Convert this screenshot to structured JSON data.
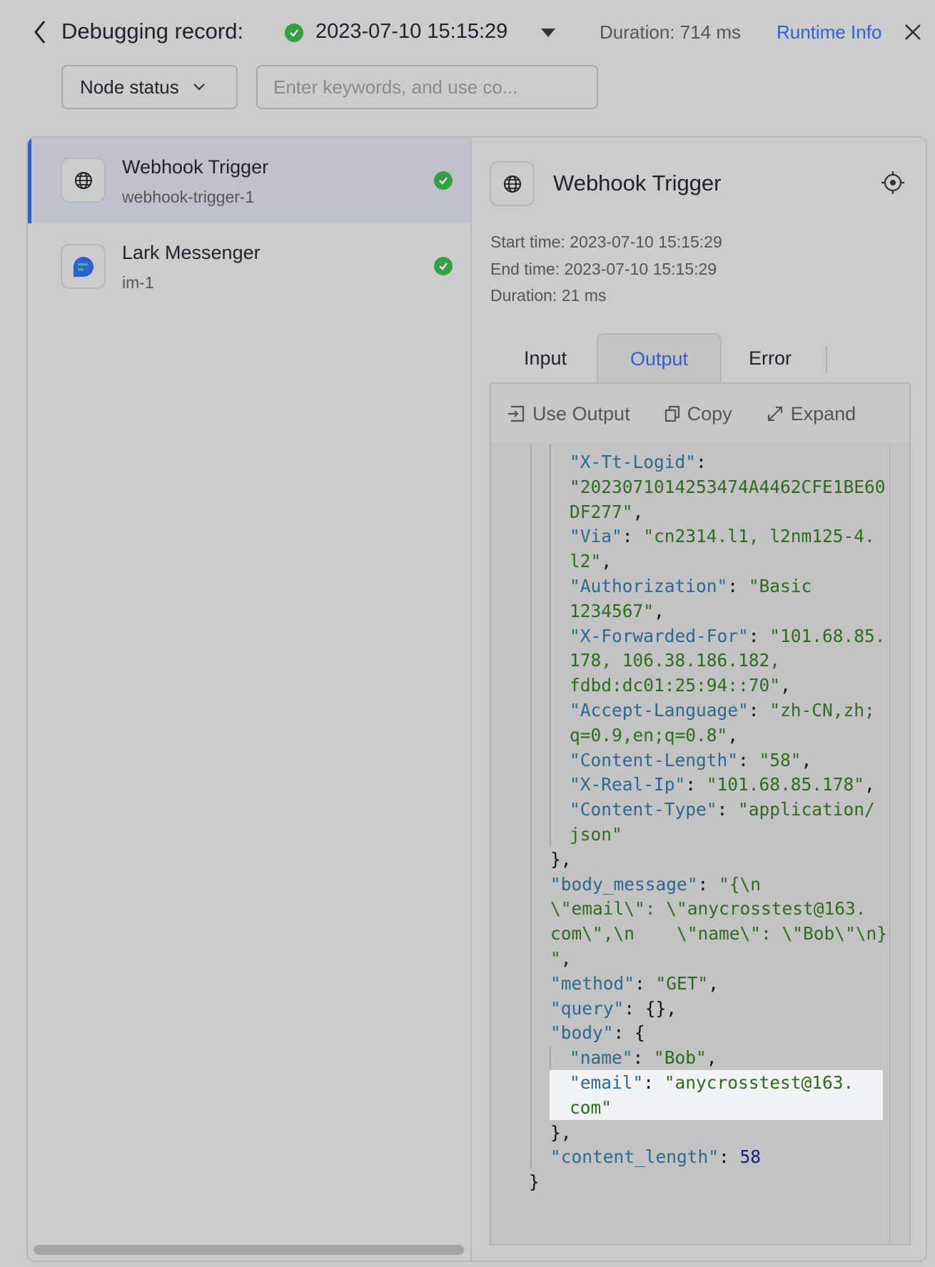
{
  "header": {
    "title": "Debugging record:",
    "record_time": "2023-07-10 15:15:29",
    "duration": "Duration: 714 ms",
    "runtime_info": "Runtime Info",
    "accent": "#2f5fd6",
    "success": "#34a043"
  },
  "filters": {
    "node_status": "Node status",
    "search_placeholder": "Enter keywords, and use co..."
  },
  "nodes": [
    {
      "title": "Webhook Trigger",
      "id": "webhook-trigger-1",
      "icon": "globe-icon",
      "status": "success",
      "selected": true
    },
    {
      "title": "Lark Messenger",
      "id": "im-1",
      "icon": "lark-messenger-icon",
      "status": "success",
      "selected": false
    }
  ],
  "detail": {
    "title": "Webhook Trigger",
    "start_time": "Start time: 2023-07-10 15:15:29",
    "end_time": "End time: 2023-07-10 15:15:29",
    "duration": "Duration: 21 ms",
    "tabs": [
      "Input",
      "Output",
      "Error"
    ],
    "active_tab": "Output",
    "toolbar": {
      "use_output": "Use Output",
      "copy": "Copy",
      "expand": "Expand"
    },
    "code_lines": [
      {
        "i": 2,
        "p": [
          [
            "k",
            "\"X-Tt-Logid\""
          ],
          [
            "p",
            ":"
          ]
        ]
      },
      {
        "i": 2,
        "p": [
          [
            "s",
            "\"2023071014253474A4462CFE1BE60"
          ]
        ]
      },
      {
        "i": 2,
        "p": [
          [
            "s",
            "DF277\""
          ],
          [
            "p",
            ","
          ]
        ]
      },
      {
        "i": 2,
        "p": [
          [
            "k",
            "\"Via\""
          ],
          [
            "p",
            ": "
          ],
          [
            "s",
            "\"cn2314.l1, l2nm125-4."
          ]
        ]
      },
      {
        "i": 2,
        "p": [
          [
            "s",
            "l2\""
          ],
          [
            "p",
            ","
          ]
        ]
      },
      {
        "i": 2,
        "p": [
          [
            "k",
            "\"Authorization\""
          ],
          [
            "p",
            ": "
          ],
          [
            "s",
            "\"Basic"
          ]
        ]
      },
      {
        "i": 2,
        "p": [
          [
            "s",
            "1234567\""
          ],
          [
            "p",
            ","
          ]
        ]
      },
      {
        "i": 2,
        "p": [
          [
            "k",
            "\"X-Forwarded-For\""
          ],
          [
            "p",
            ": "
          ],
          [
            "s",
            "\"101.68.85."
          ]
        ]
      },
      {
        "i": 2,
        "p": [
          [
            "s",
            "178, 106.38.186.182,"
          ]
        ]
      },
      {
        "i": 2,
        "p": [
          [
            "s",
            "fdbd:dc01:25:94::70\""
          ],
          [
            "p",
            ","
          ]
        ]
      },
      {
        "i": 2,
        "p": [
          [
            "k",
            "\"Accept-Language\""
          ],
          [
            "p",
            ": "
          ],
          [
            "s",
            "\"zh-CN,zh;"
          ]
        ]
      },
      {
        "i": 2,
        "p": [
          [
            "s",
            "q=0.9,en;q=0.8\""
          ],
          [
            "p",
            ","
          ]
        ]
      },
      {
        "i": 2,
        "p": [
          [
            "k",
            "\"Content-Length\""
          ],
          [
            "p",
            ": "
          ],
          [
            "s",
            "\"58\""
          ],
          [
            "p",
            ","
          ]
        ]
      },
      {
        "i": 2,
        "p": [
          [
            "k",
            "\"X-Real-Ip\""
          ],
          [
            "p",
            ": "
          ],
          [
            "s",
            "\"101.68.85.178\""
          ],
          [
            "p",
            ","
          ]
        ]
      },
      {
        "i": 2,
        "p": [
          [
            "k",
            "\"Content-Type\""
          ],
          [
            "p",
            ": "
          ],
          [
            "s",
            "\"application/"
          ]
        ]
      },
      {
        "i": 2,
        "p": [
          [
            "s",
            "json\""
          ]
        ]
      },
      {
        "i": 1,
        "p": [
          [
            "p",
            "},"
          ]
        ]
      },
      {
        "i": 1,
        "p": [
          [
            "k",
            "\"body_message\""
          ],
          [
            "p",
            ": "
          ],
          [
            "s",
            "\"{\\n"
          ]
        ]
      },
      {
        "i": 1,
        "p": [
          [
            "s",
            "\\\"email\\\": \\\"anycrosstest@163."
          ]
        ]
      },
      {
        "i": 1,
        "p": [
          [
            "s",
            "com\\\",\\n    \\\"name\\\": \\\"Bob\\\"\\n}"
          ]
        ]
      },
      {
        "i": 1,
        "p": [
          [
            "s",
            "\""
          ],
          [
            "p",
            ","
          ]
        ]
      },
      {
        "i": 1,
        "p": [
          [
            "k",
            "\"method\""
          ],
          [
            "p",
            ": "
          ],
          [
            "s",
            "\"GET\""
          ],
          [
            "p",
            ","
          ]
        ]
      },
      {
        "i": 1,
        "p": [
          [
            "k",
            "\"query\""
          ],
          [
            "p",
            ": {},"
          ]
        ]
      },
      {
        "i": 1,
        "p": [
          [
            "k",
            "\"body\""
          ],
          [
            "p",
            ": {"
          ]
        ]
      },
      {
        "i": 2,
        "p": [
          [
            "k",
            "\"name\""
          ],
          [
            "p",
            ": "
          ],
          [
            "s",
            "\"Bob\""
          ],
          [
            "p",
            ","
          ]
        ]
      },
      {
        "i": 2,
        "h": true,
        "p": [
          [
            "k",
            "\"email\""
          ],
          [
            "p",
            ": "
          ],
          [
            "s",
            "\"anycrosstest@163."
          ]
        ]
      },
      {
        "i": 2,
        "h": true,
        "p": [
          [
            "s",
            "com\""
          ]
        ]
      },
      {
        "i": 1,
        "p": [
          [
            "p",
            "},"
          ]
        ]
      },
      {
        "i": 1,
        "p": [
          [
            "k",
            "\"content_length\""
          ],
          [
            "p",
            ": "
          ],
          [
            "n",
            "58"
          ]
        ]
      },
      {
        "i": 0,
        "p": [
          [
            "p",
            "}"
          ]
        ]
      }
    ]
  }
}
